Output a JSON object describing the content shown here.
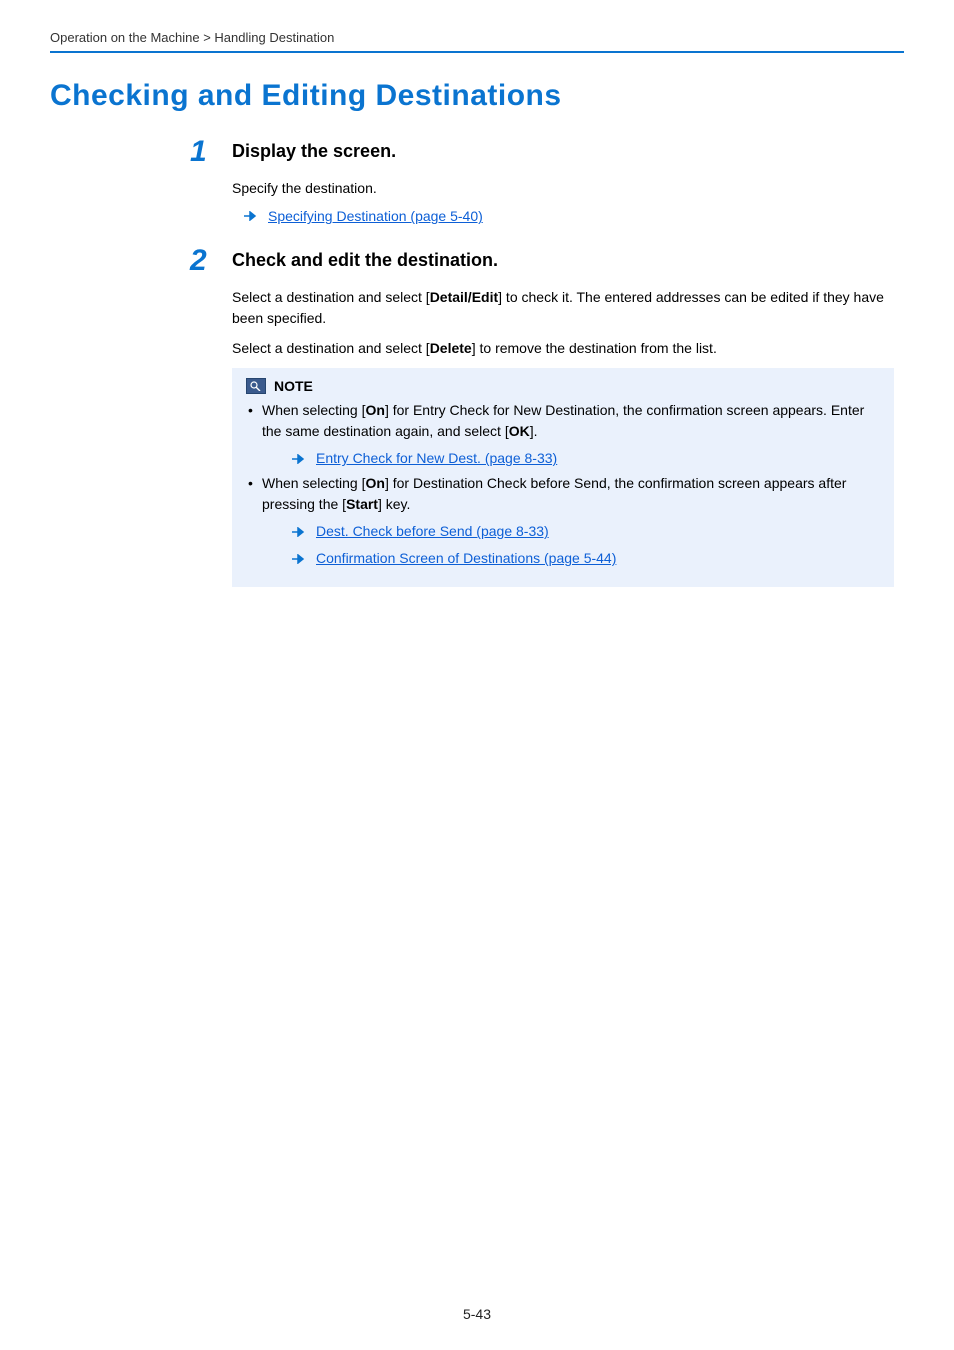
{
  "breadcrumb": "Operation on the Machine > Handling Destination",
  "main_title": "Checking and Editing Destinations",
  "step1": {
    "num": "1",
    "title": "Display the screen.",
    "p1": "Specify the destination.",
    "link1": "Specifying Destination (page 5-40)"
  },
  "step2": {
    "num": "2",
    "title": "Check and edit the destination.",
    "p1a": "Select a destination and select [",
    "p1b": "Detail/Edit",
    "p1c": "] to check it. The entered addresses can be edited if they have been specified.",
    "p2a": "Select a destination and select [",
    "p2b": "Delete",
    "p2c": "] to remove the destination from the list.",
    "note_label": "NOTE",
    "li1a": "When selecting [",
    "li1b": "On",
    "li1c": "] for Entry Check for New Destination, the confirmation screen appears. Enter the same destination again, and select [",
    "li1d": "OK",
    "li1e": "].",
    "li1_link": "Entry Check for New Dest. (page 8-33)",
    "li2a": "When selecting [",
    "li2b": "On",
    "li2c": "] for Destination Check before Send, the confirmation screen appears after pressing the [",
    "li2d": "Start",
    "li2e": "] key.",
    "li2_link1": "Dest. Check before Send (page 8-33)",
    "li2_link2": "Confirmation Screen of Destinations (page 5-44)"
  },
  "page_number": "5-43"
}
